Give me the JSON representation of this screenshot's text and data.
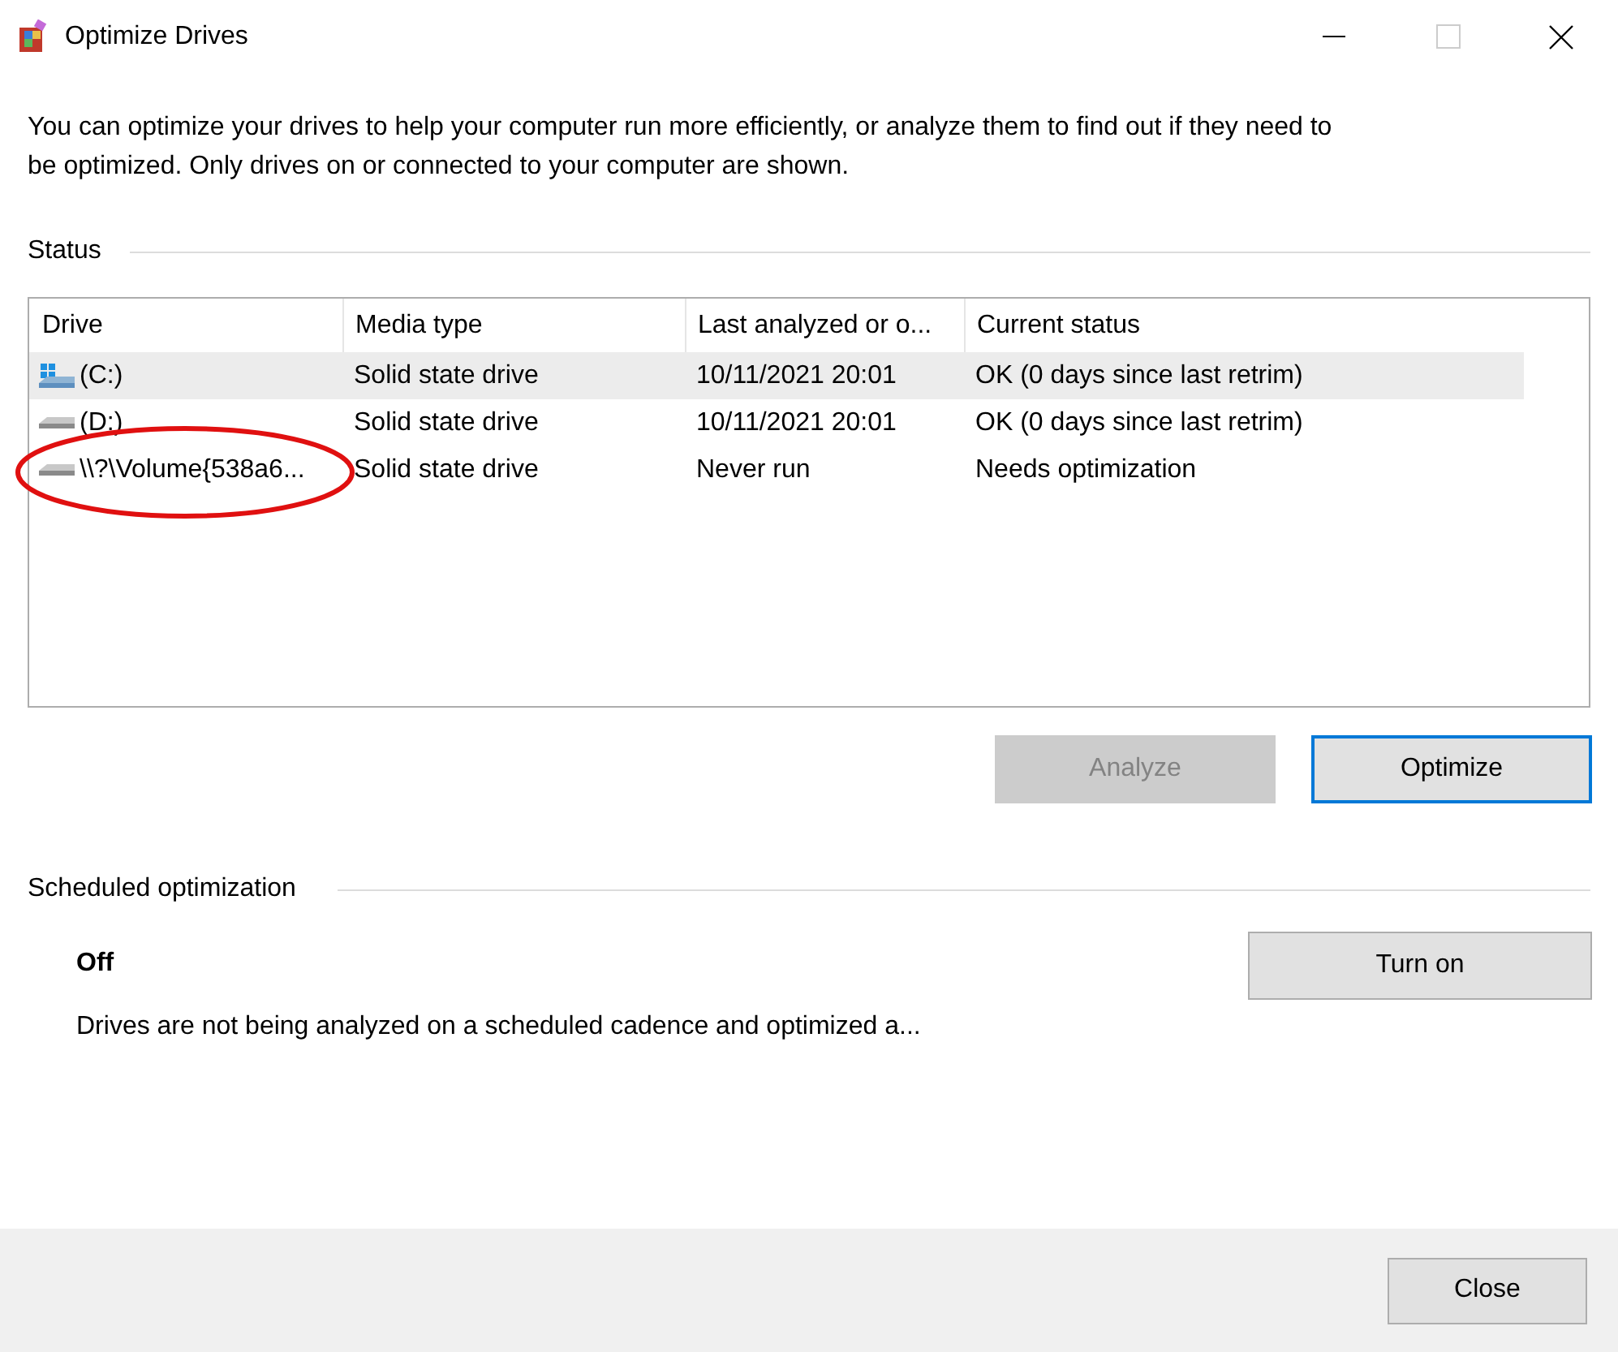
{
  "window": {
    "title": "Optimize Drives"
  },
  "description": "You can optimize your drives to help your computer run more efficiently, or analyze them to find out if they need to be optimized. Only drives on or connected to your computer are shown.",
  "status": {
    "heading": "Status",
    "table": {
      "columns": [
        "Drive",
        "Media type",
        "Last analyzed or o...",
        "Current status"
      ],
      "rows": [
        {
          "kind": "system",
          "selected": true,
          "cells": [
            "(C:)",
            "Solid state drive",
            "10/11/2021 20:01",
            "OK (0 days since last retrim)"
          ]
        },
        {
          "kind": "plain",
          "selected": false,
          "cells": [
            "(D:)",
            "Solid state drive",
            "10/11/2021 20:01",
            "OK (0 days since last retrim)"
          ]
        },
        {
          "kind": "plain",
          "selected": false,
          "cells": [
            "\\\\?\\Volume{538a6...",
            "Solid state drive",
            "Never run",
            "Needs optimization"
          ]
        }
      ]
    },
    "buttons": [
      {
        "label": "Analyze",
        "disabled": true,
        "default": false
      },
      {
        "label": "Optimize",
        "disabled": false,
        "default": true
      }
    ]
  },
  "scheduled": {
    "heading": "Scheduled optimization",
    "state": "Off",
    "detail": "Drives are not being analyzed on a scheduled cadence and optimized a...",
    "button": "Turn on"
  },
  "footer": {
    "button": "Close"
  }
}
